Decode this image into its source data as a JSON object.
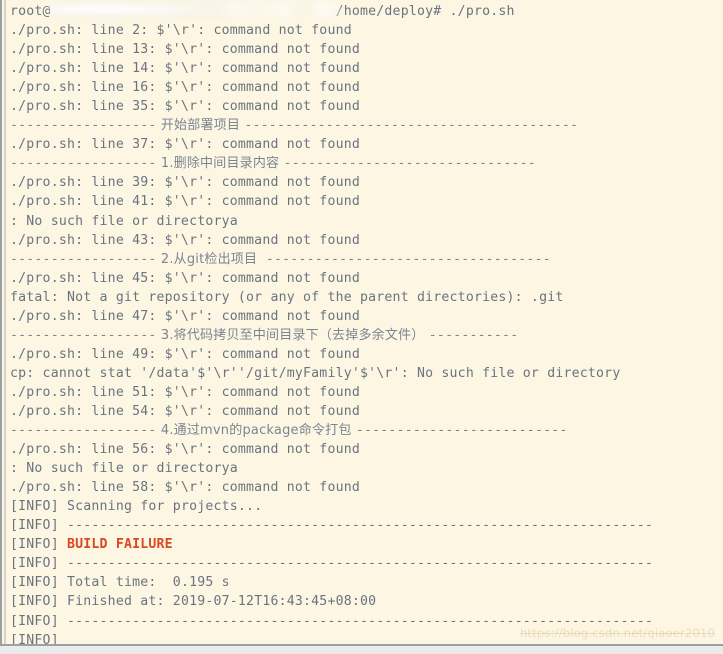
{
  "window": {
    "background_color": "#fdf6e3",
    "text_color": "#6a7480",
    "failure_color": "#d9481f",
    "border_color": "#9aa0a6",
    "page_background": "#ebebeb"
  },
  "prompt": {
    "user_host_prefix": "root@",
    "hostname_redacted": true,
    "path": "/home/deploy#",
    "command": "./pro.sh"
  },
  "terminal_lines": [
    {
      "id": "line-prompt",
      "kind": "prompt",
      "text": "root@                                   /home/deploy# ./pro.sh"
    },
    {
      "id": "line-err-2",
      "kind": "error",
      "text": "./pro.sh: line 2: $'\\r': command not found"
    },
    {
      "id": "line-err-13",
      "kind": "error",
      "text": "./pro.sh: line 13: $'\\r': command not found"
    },
    {
      "id": "line-err-14",
      "kind": "error",
      "text": "./pro.sh: line 14: $'\\r': command not found"
    },
    {
      "id": "line-err-16",
      "kind": "error",
      "text": "./pro.sh: line 16: $'\\r': command not found"
    },
    {
      "id": "line-err-35",
      "kind": "error",
      "text": "./pro.sh: line 35: $'\\r': command not found"
    },
    {
      "id": "sep-deploy",
      "kind": "separator",
      "dashes_before": "------------------",
      "label": " 开始部署项目 ",
      "dashes_after": "-----------------------------------------"
    },
    {
      "id": "line-err-37",
      "kind": "error",
      "text": "./pro.sh: line 37: $'\\r': command not found"
    },
    {
      "id": "sep-step-1",
      "kind": "separator",
      "dashes_before": "------------------",
      "label": " 1.删除中间目录内容 ",
      "dashes_after": "-------------------------------"
    },
    {
      "id": "line-err-39",
      "kind": "error",
      "text": "./pro.sh: line 39: $'\\r': command not found"
    },
    {
      "id": "line-err-41",
      "kind": "error",
      "text": "./pro.sh: line 41: $'\\r': command not found"
    },
    {
      "id": "line-nosuch-1",
      "kind": "error",
      "text": ": No such file or directorya"
    },
    {
      "id": "line-err-43",
      "kind": "error",
      "text": "./pro.sh: line 43: $'\\r': command not found"
    },
    {
      "id": "sep-step-2",
      "kind": "separator",
      "dashes_before": "------------------",
      "label": " 2.从git检出项目  ",
      "dashes_after": "-----------------------------------"
    },
    {
      "id": "line-err-45",
      "kind": "error",
      "text": "./pro.sh: line 45: $'\\r': command not found"
    },
    {
      "id": "line-git-fatal",
      "kind": "error",
      "text": "fatal: Not a git repository (or any of the parent directories): .git"
    },
    {
      "id": "line-err-47",
      "kind": "error",
      "text": "./pro.sh: line 47: $'\\r': command not found"
    },
    {
      "id": "sep-step-3",
      "kind": "separator",
      "dashes_before": "------------------",
      "label": " 3.将代码拷贝至中间目录下（去掉多余文件） ",
      "dashes_after": "-----------"
    },
    {
      "id": "line-err-49",
      "kind": "error",
      "text": "./pro.sh: line 49: $'\\r': command not found"
    },
    {
      "id": "line-cp-fail",
      "kind": "error",
      "text": "cp: cannot stat '/data'$'\\r''/git/myFamily'$'\\r': No such file or directory"
    },
    {
      "id": "line-err-51",
      "kind": "error",
      "text": "./pro.sh: line 51: $'\\r': command not found"
    },
    {
      "id": "line-err-54",
      "kind": "error",
      "text": "./pro.sh: line 54: $'\\r': command not found"
    },
    {
      "id": "sep-step-4",
      "kind": "separator",
      "dashes_before": "------------------",
      "label": " 4.通过mvn的package命令打包 ",
      "dashes_after": "--------------------------"
    },
    {
      "id": "line-err-56",
      "kind": "error",
      "text": "./pro.sh: line 56: $'\\r': command not found"
    },
    {
      "id": "line-nosuch-2",
      "kind": "error",
      "text": ": No such file or directorya"
    },
    {
      "id": "line-err-58",
      "kind": "error",
      "text": "./pro.sh: line 58: $'\\r': command not found"
    },
    {
      "id": "mvn-scanning",
      "kind": "info",
      "tag": "[INFO] ",
      "text": "Scanning for projects..."
    },
    {
      "id": "mvn-rule-1",
      "kind": "info",
      "tag": "[INFO] ",
      "text": "------------------------------------------------------------------------"
    },
    {
      "id": "mvn-status",
      "kind": "info-failure",
      "tag": "[INFO] ",
      "text": "BUILD FAILURE"
    },
    {
      "id": "mvn-rule-2",
      "kind": "info",
      "tag": "[INFO] ",
      "text": "------------------------------------------------------------------------"
    },
    {
      "id": "mvn-total-time",
      "kind": "info",
      "tag": "[INFO] ",
      "text": "Total time:  0.195 s"
    },
    {
      "id": "mvn-finished-at",
      "kind": "info",
      "tag": "[INFO] ",
      "text": "Finished at: 2019-07-12T16:43:45+08:00"
    },
    {
      "id": "mvn-rule-3",
      "kind": "info",
      "tag": "[INFO] ",
      "text": "------------------------------------------------------------------------"
    },
    {
      "id": "mvn-tail",
      "kind": "info",
      "tag": "[INFO] ",
      "text": ""
    }
  ],
  "build": {
    "status": "BUILD FAILURE",
    "total_time": "0.195 s",
    "finished_at": "2019-07-12T16:43:45+08:00"
  },
  "watermark": {
    "text": "https://blog.csdn.net/qiaoer2010"
  }
}
